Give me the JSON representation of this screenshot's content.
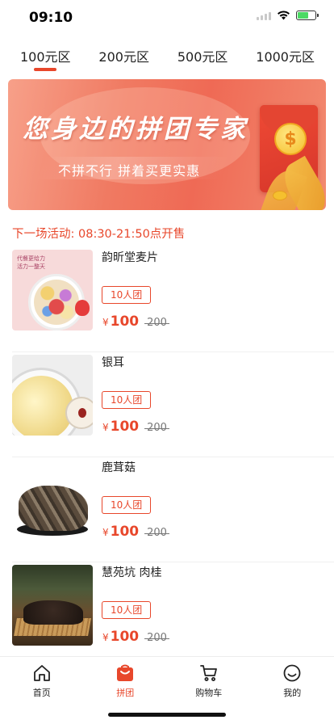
{
  "status_bar": {
    "time": "09:10"
  },
  "tabs": [
    {
      "label": "100元区",
      "active": true
    },
    {
      "label": "200元区",
      "active": false
    },
    {
      "label": "500元区",
      "active": false
    },
    {
      "label": "1000元区",
      "active": false
    }
  ],
  "banner": {
    "title": "您身边的拼团专家",
    "subtitle": "不拼不行 拼着买更实惠",
    "coin_symbol": "$"
  },
  "next_activity": "下一场活动: 08:30-21:50点开售",
  "products": [
    {
      "name": "韵昕堂麦片",
      "group_tag": "10人团",
      "price_symbol": "¥",
      "price": "100",
      "original_price": "200",
      "image_caption": "代餐更给力\n活力一整天"
    },
    {
      "name": "银耳",
      "group_tag": "10人团",
      "price_symbol": "¥",
      "price": "100",
      "original_price": "200"
    },
    {
      "name": "鹿茸菇",
      "group_tag": "10人团",
      "price_symbol": "¥",
      "price": "100",
      "original_price": "200"
    },
    {
      "name": "慧苑坑 肉桂",
      "group_tag": "10人团",
      "price_symbol": "¥",
      "price": "100",
      "original_price": "200"
    }
  ],
  "bottom_nav": [
    {
      "label": "首页",
      "icon": "home-icon",
      "active": false
    },
    {
      "label": "拼团",
      "icon": "shopping-bag-icon",
      "active": true
    },
    {
      "label": "购物车",
      "icon": "cart-icon",
      "active": false
    },
    {
      "label": "我的",
      "icon": "smiley-icon",
      "active": false
    }
  ],
  "colors": {
    "accent": "#e8472b",
    "text": "#222222",
    "muted": "#777777"
  }
}
